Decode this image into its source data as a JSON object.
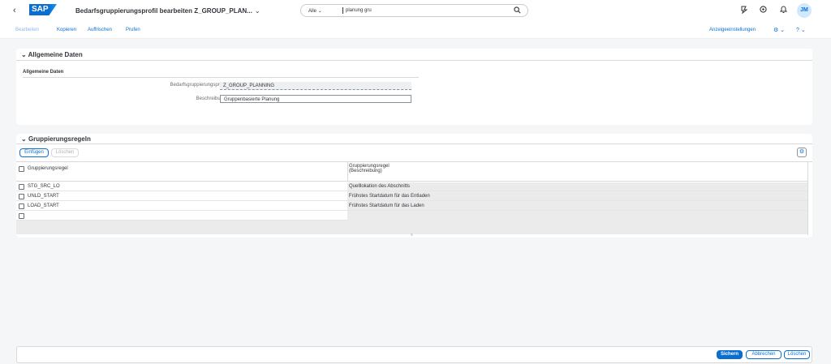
{
  "shell": {
    "back_glyph": "‹",
    "logo_text": "SAP",
    "title": "Bedarfsgruppierungsprofil bearbeiten Z_GROUP_PLAN...",
    "title_chevron": "⌄",
    "search": {
      "scope": "Alle",
      "scope_chevron": "⌄",
      "value": "planung gru",
      "icon": "search-icon"
    },
    "avatar_initials": "JM"
  },
  "toolbar": {
    "edit_label": "Bearbeiten",
    "copy_label": "Kopieren",
    "refresh_label": "Auffrischen",
    "check_label": "Prufen",
    "display_settings_label": "Anzeigeeinstellungen",
    "settings_glyph": "⚙",
    "help_glyph": "?",
    "chevron_glyph": "⌄"
  },
  "general_section": {
    "title": "Allgemeine Daten",
    "collapse_glyph": "⌄",
    "subheading": "Allgemeine Daten",
    "profile_label": "Bedarfsgruppierungsprofil:",
    "profile_value": "Z_GROUP_PLANNING",
    "description_label": "Beschreibung:",
    "description_value": "Gruppenbasierte Planung"
  },
  "rules_section": {
    "title": "Gruppierungsregeln",
    "collapse_glyph": "⌄",
    "insert_label": "Einfügen",
    "delete_label": "Löschen",
    "settings_glyph": "⚙",
    "col_rule": "Gruppierungsregel",
    "col_desc_line1": "Gruppierungsregel",
    "col_desc_line2": "(Beschreibung)",
    "rows": [
      {
        "rule": "STG_SRC_LO",
        "desc": "Quelllokation des Abschnitts"
      },
      {
        "rule": "UNLD_START",
        "desc": "Frühstes Startdatum für das Entladen"
      },
      {
        "rule": "LOAD_START",
        "desc": "Frühstes Startdatum für das Laden"
      },
      {
        "rule": "",
        "desc": ""
      }
    ],
    "resize_handle": "≡"
  },
  "footer": {
    "save_label": "Sichern",
    "cancel_label": "Abbrechen",
    "delete_label": "Löschen"
  },
  "colors": {
    "accent": "#0a6ed1",
    "page_bg": "#f5f6f7"
  }
}
